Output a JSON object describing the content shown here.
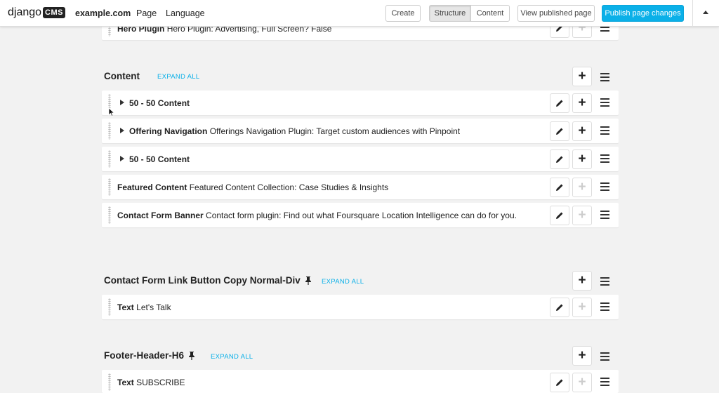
{
  "toolbar": {
    "logo_text": "django",
    "logo_badge": "CMS",
    "site": "example.com",
    "menu_page": "Page",
    "menu_language": "Language",
    "create": "Create",
    "structure": "Structure",
    "content": "Content",
    "view_published": "View published page",
    "publish": "Publish page changes"
  },
  "top_row": {
    "name": "Hero Plugin",
    "desc": "Hero Plugin: Advertising, Full Screen? False"
  },
  "sections": {
    "content": {
      "title": "Content",
      "expand": "EXPAND ALL"
    },
    "contact_link": {
      "title": "Contact Form Link Button Copy Normal-Div",
      "expand": "EXPAND ALL"
    },
    "footer": {
      "title": "Footer-Header-H6",
      "expand": "EXPAND ALL"
    }
  },
  "content_rows": [
    {
      "name": "50 - 50 Content",
      "desc": ""
    },
    {
      "name": "Offering Navigation",
      "desc": "Offerings Navigation Plugin: Target custom audiences with Pinpoint"
    },
    {
      "name": "50 - 50 Content",
      "desc": ""
    },
    {
      "name": "Featured Content",
      "desc": "Featured Content Collection: Case Studies & Insights"
    },
    {
      "name": "Contact Form Banner",
      "desc": "Contact form plugin: Find out what Foursquare Location Intelligence can do for you."
    }
  ],
  "contact_row": {
    "name": "Text",
    "desc": "Let's Talk"
  },
  "footer_row": {
    "name": "Text",
    "desc": "SUBSCRIBE"
  }
}
